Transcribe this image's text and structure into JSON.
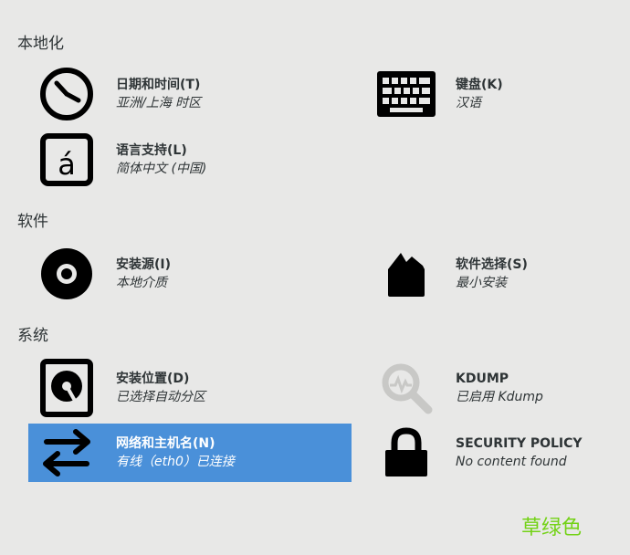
{
  "sections": {
    "localization": {
      "title": "本地化"
    },
    "software": {
      "title": "软件"
    },
    "system": {
      "title": "系统"
    }
  },
  "spokes": {
    "datetime": {
      "title": "日期和时间(T)",
      "status": "亚洲/上海 时区",
      "icon": "clock-icon"
    },
    "keyboard": {
      "title": "键盘(K)",
      "status": "汉语",
      "icon": "keyboard-icon"
    },
    "language": {
      "title": "语言支持(L)",
      "status": "简体中文 (中国)",
      "icon": "language-icon"
    },
    "source": {
      "title": "安装源(I)",
      "status": "本地介质",
      "icon": "disc-icon"
    },
    "software": {
      "title": "软件选择(S)",
      "status": "最小安装",
      "icon": "package-icon"
    },
    "destination": {
      "title": "安装位置(D)",
      "status": "已选择自动分区",
      "icon": "disk-icon"
    },
    "kdump": {
      "title": "KDUMP",
      "status": "已启用 Kdump",
      "icon": "magnifier-icon"
    },
    "network": {
      "title": "网络和主机名(N)",
      "status": "有线（eth0）已连接",
      "icon": "network-arrows-icon"
    },
    "security": {
      "title": "SECURITY POLICY",
      "status": "No content found",
      "icon": "lock-icon"
    }
  },
  "footer": {
    "brand": "草绿色"
  },
  "colors": {
    "selected": "#4a90d9",
    "brand": "#73d216",
    "background": "#e8e8e7"
  }
}
